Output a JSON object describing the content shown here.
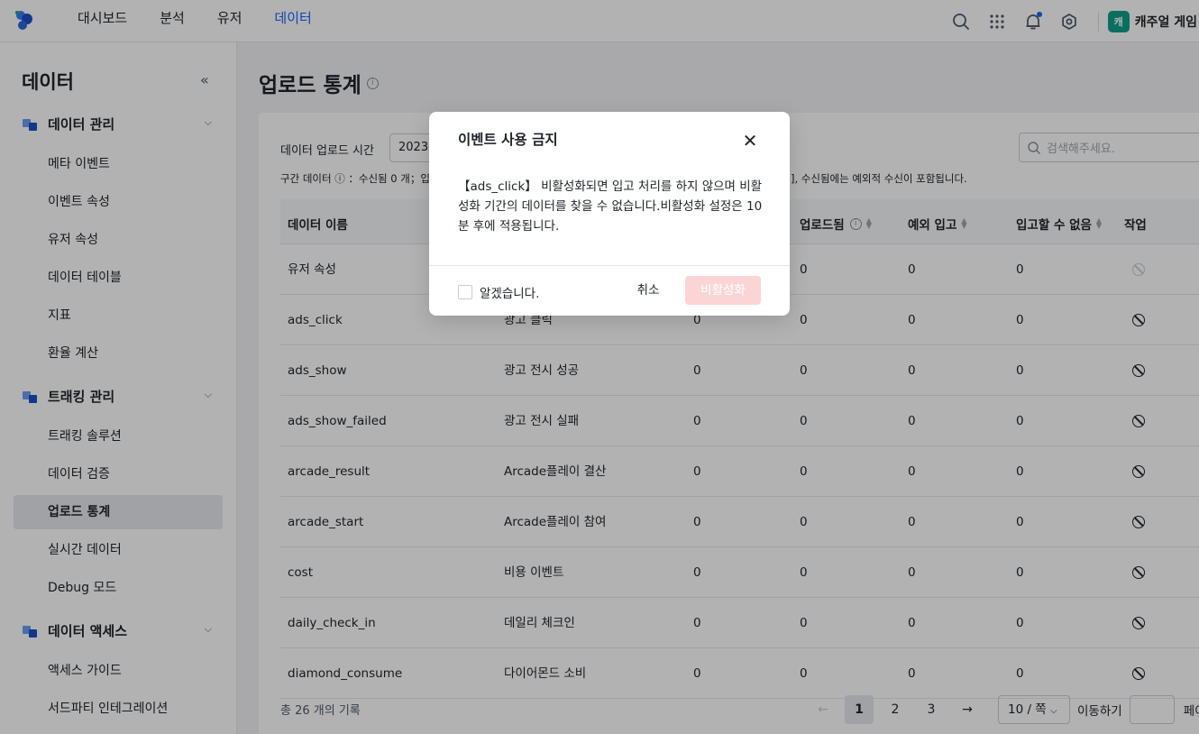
{
  "topbar": {
    "nav": [
      {
        "label": "대시보드",
        "active": false
      },
      {
        "label": "분석",
        "active": false
      },
      {
        "label": "유저",
        "active": false
      },
      {
        "label": "데이터",
        "active": true
      }
    ],
    "icons": [
      "search-icon",
      "apps-grid-icon",
      "bell-icon",
      "gear-icon"
    ],
    "game_badge": "캐",
    "game_name": "캐주얼 게임"
  },
  "sidebar": {
    "title": "데이터",
    "collapse_glyph": "«",
    "groups": [
      {
        "label": "데이터 관리",
        "items": [
          "메타 이벤트",
          "이벤트 속성",
          "유저 속성",
          "데이터 테이블",
          "지표",
          "환율 계산"
        ]
      },
      {
        "label": "트래킹 관리",
        "items": [
          "트래킹 솔루션",
          "데이터 검증",
          "업로드 통계",
          "실시간 데이터",
          "Debug 모드"
        ]
      },
      {
        "label": "데이터 액세스",
        "items": [
          "액세스 가이드",
          "서드파티 인테그레이션"
        ]
      }
    ],
    "active_item": "업로드 통계"
  },
  "main": {
    "title": "업로드 통계",
    "filter_label": "데이터 업로드 시간",
    "date_value": "2023-",
    "search_placeholder": "검색해주세요.",
    "note_left": "구간 데이터 ⓘ ：수신됨 0 개；입",
    "note_right": "], 수신됨에는 예외적 수신이 포함됩니다.",
    "columns": [
      "데이터 이름",
      "",
      "",
      "업로드됨",
      "예외 입고",
      "입고할 수 없음",
      "작업"
    ],
    "rows": [
      {
        "name": "유저 속성",
        "display": "",
        "c1": "",
        "uploaded": "0",
        "exception": "0",
        "cannot": "0",
        "action_disabled": true
      },
      {
        "name": "ads_click",
        "display": "광고 클릭",
        "c1": "0",
        "uploaded": "0",
        "exception": "0",
        "cannot": "0",
        "action_disabled": false
      },
      {
        "name": "ads_show",
        "display": "광고 전시 성공",
        "c1": "0",
        "uploaded": "0",
        "exception": "0",
        "cannot": "0",
        "action_disabled": false
      },
      {
        "name": "ads_show_failed",
        "display": "광고 전시 실패",
        "c1": "0",
        "uploaded": "0",
        "exception": "0",
        "cannot": "0",
        "action_disabled": false
      },
      {
        "name": "arcade_result",
        "display": "Arcade플레이 결산",
        "c1": "0",
        "uploaded": "0",
        "exception": "0",
        "cannot": "0",
        "action_disabled": false
      },
      {
        "name": "arcade_start",
        "display": "Arcade플레이 참여",
        "c1": "0",
        "uploaded": "0",
        "exception": "0",
        "cannot": "0",
        "action_disabled": false
      },
      {
        "name": "cost",
        "display": "비용 이벤트",
        "c1": "0",
        "uploaded": "0",
        "exception": "0",
        "cannot": "0",
        "action_disabled": false
      },
      {
        "name": "daily_check_in",
        "display": "데일리 체크인",
        "c1": "0",
        "uploaded": "0",
        "exception": "0",
        "cannot": "0",
        "action_disabled": false
      },
      {
        "name": "diamond_consume",
        "display": "다이어몬드 소비",
        "c1": "0",
        "uploaded": "0",
        "exception": "0",
        "cannot": "0",
        "action_disabled": false
      }
    ],
    "total": "총 26 개의 기록",
    "pagination": {
      "prev": "←",
      "pages": [
        "1",
        "2",
        "3"
      ],
      "current": "1",
      "next": "→",
      "page_size": "10 / 쪽",
      "goto_label": "이동하기",
      "tail": "페이"
    }
  },
  "modal": {
    "title": "이벤트 사용 금지",
    "body": "【ads_click】 비활성화되면 입고 처리를 하지 않으며 비활성화 기간의 데이터를 찾을 수 없습니다.비활성화 설정은 10분 후에 적용됩니다.",
    "ack_label": "알겠습니다.",
    "cancel_label": "취소",
    "confirm_label": "비활성화"
  },
  "colors": {
    "accent": "#1664ff",
    "badge": "#11a08a",
    "danger_disabled": "#fbd5d5"
  }
}
